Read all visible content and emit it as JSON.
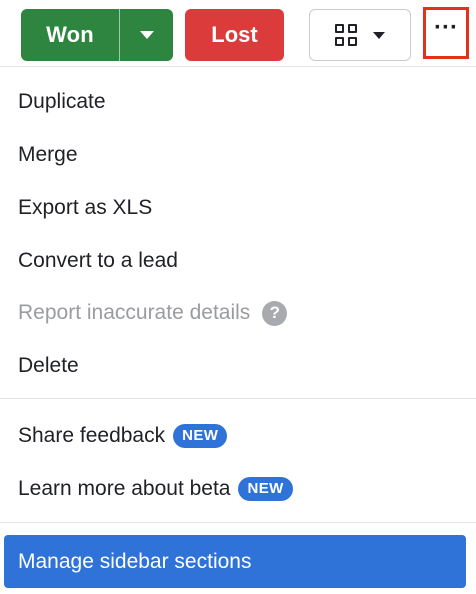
{
  "toolbar": {
    "won_label": "Won",
    "lost_label": "Lost",
    "more_label": "···",
    "colors": {
      "won": "#2e8540",
      "lost": "#db3b3b",
      "more_highlight": "#e2321b"
    },
    "icons": {
      "won_dropdown": "chevron-down-icon",
      "view": "grid-view-icon",
      "view_dropdown": "chevron-down-icon",
      "more": "more-horizontal-icon"
    }
  },
  "menu": {
    "items": [
      {
        "label": "Duplicate"
      },
      {
        "label": "Merge"
      },
      {
        "label": "Export as XLS"
      },
      {
        "label": "Convert to a lead"
      },
      {
        "label": "Report inaccurate details",
        "disabled": true,
        "icon": "help-icon",
        "icon_glyph": "?"
      },
      {
        "label": "Delete"
      }
    ],
    "secondary": [
      {
        "label": "Share feedback",
        "badge": "NEW"
      },
      {
        "label": "Learn more about beta",
        "badge": "NEW"
      }
    ],
    "primary_action": {
      "label": "Manage sidebar sections"
    },
    "colors": {
      "accent": "#2f72d8",
      "disabled_text": "#9a9ca1"
    }
  }
}
